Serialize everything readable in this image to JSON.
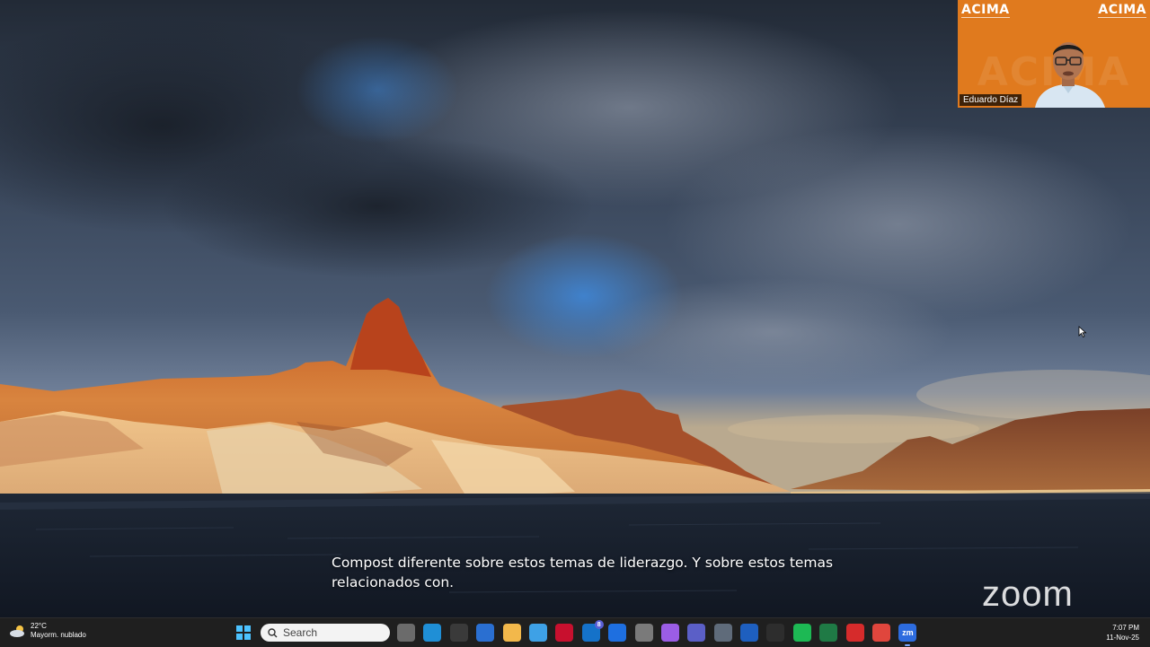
{
  "video_tile": {
    "participant_name": "Eduardo Díaz",
    "logo_left": "ACIMA",
    "logo_right": "ACIMA",
    "background_text": "ACIMA",
    "background_color": "#e07a1e"
  },
  "captions": {
    "line1": "Compost diferente sobre estos temas de liderazgo. Y sobre estos temas",
    "line2": "relacionados con."
  },
  "watermark": {
    "text": "zoom"
  },
  "taskbar": {
    "weather": {
      "temperature": "22°C",
      "condition": "Mayorm. nublado",
      "icon": "partly-cloudy-icon"
    },
    "search": {
      "placeholder": "Search"
    },
    "apps": [
      {
        "name": "task-view-icon",
        "color": "#6b6b6b"
      },
      {
        "name": "edge-icon",
        "color": "#1f8fd6"
      },
      {
        "name": "microsoft-store-icon",
        "color": "#3a3a3a"
      },
      {
        "name": "hp-icon",
        "color": "#2a6fd1"
      },
      {
        "name": "file-explorer-icon",
        "color": "#f2b84b"
      },
      {
        "name": "chrome-edge-icon",
        "color": "#3ea1e6"
      },
      {
        "name": "mcafee-icon",
        "color": "#c8102e"
      },
      {
        "name": "outlook-icon",
        "color": "#1572c9",
        "badge": "8"
      },
      {
        "name": "dropbox-icon",
        "color": "#1e6fe0"
      },
      {
        "name": "notepad-icon",
        "color": "#7a7a7a"
      },
      {
        "name": "snipping-tool-icon",
        "color": "#9b5de5"
      },
      {
        "name": "teams-icon",
        "color": "#5b5fc7"
      },
      {
        "name": "settings-icon",
        "color": "#5f6b7a"
      },
      {
        "name": "word-icon",
        "color": "#1e5fbf"
      },
      {
        "name": "obs-icon",
        "color": "#2d2d2d"
      },
      {
        "name": "spotify-icon",
        "color": "#1db954"
      },
      {
        "name": "excel-icon",
        "color": "#1f7a45"
      },
      {
        "name": "acrobat-icon",
        "color": "#d62b2b"
      },
      {
        "name": "photos-icon",
        "color": "#e0463d"
      },
      {
        "name": "zoom-icon",
        "color": "#2d6cdf",
        "label": "zm",
        "active": true
      }
    ],
    "clock": {
      "time": "7:07 PM",
      "date": "11-Nov-25"
    }
  }
}
